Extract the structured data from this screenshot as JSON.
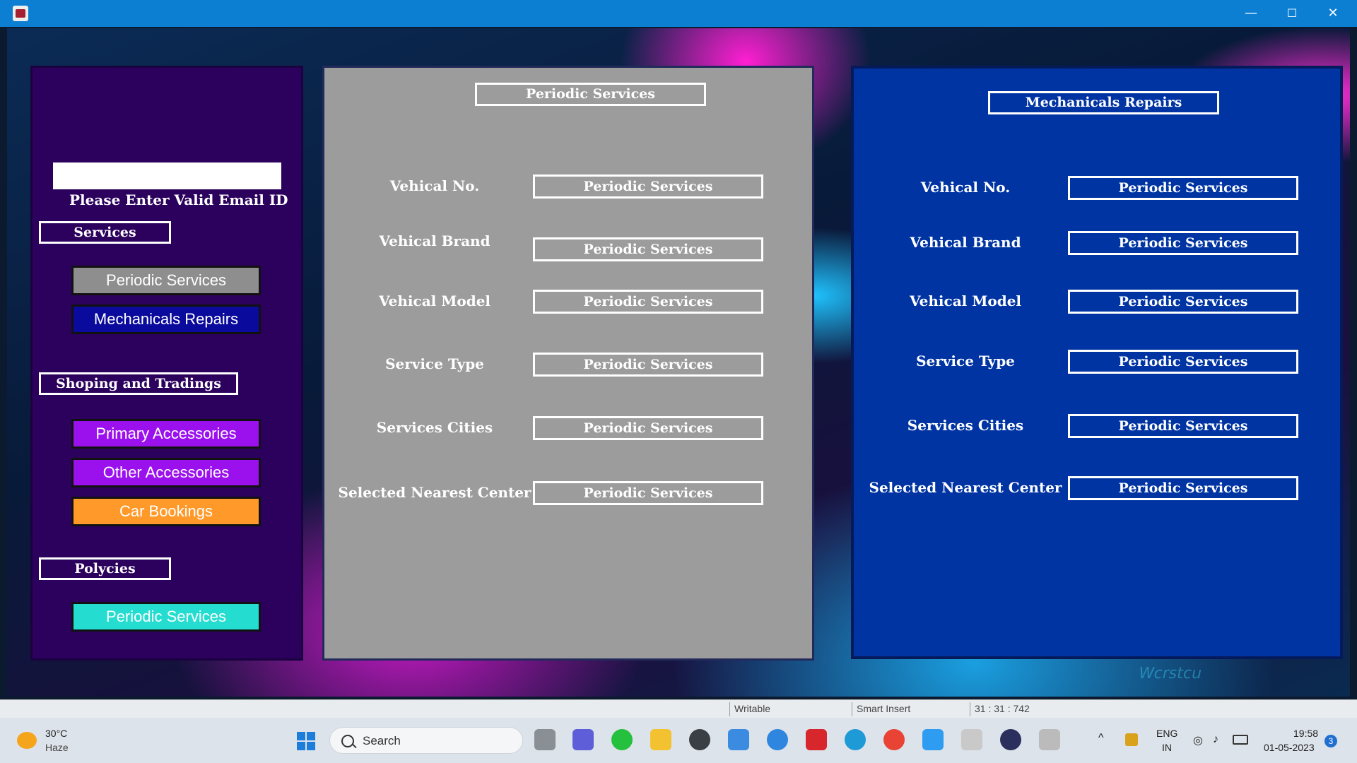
{
  "window": {
    "minimize": "—",
    "maximize": "☐",
    "close": "✕"
  },
  "background": {
    "watermark": "Wcrstcu"
  },
  "left": {
    "email_placeholder": "",
    "email_hint": "Please Enter Valid Email ID",
    "services_header": "Services",
    "periodic_btn": "Periodic Services",
    "mechanical_btn": "Mechanicals Repairs",
    "shopping_header": "Shoping and Tradings",
    "primary_btn": "Primary Accessories",
    "other_btn": "Other Accessories",
    "car_btn": "Car Bookings",
    "policies_header": "Polycies",
    "policies_btn": "Periodic Services"
  },
  "middle": {
    "title": "Periodic Services",
    "rows": [
      {
        "label": "Vehical No.",
        "value": "Periodic Services"
      },
      {
        "label": "Vehical Brand",
        "value": "Periodic Services"
      },
      {
        "label": "Vehical Model",
        "value": "Periodic Services"
      },
      {
        "label": "Service Type",
        "value": "Periodic Services"
      },
      {
        "label": "Services Cities",
        "value": "Periodic Services"
      },
      {
        "label": "Selected Nearest Center",
        "value": "Periodic Services"
      }
    ]
  },
  "right": {
    "title": "Mechanicals Repairs",
    "rows": [
      {
        "label": "Vehical No.",
        "value": "Periodic Services"
      },
      {
        "label": "Vehical Brand",
        "value": "Periodic Services"
      },
      {
        "label": "Vehical Model",
        "value": "Periodic Services"
      },
      {
        "label": "Service Type",
        "value": "Periodic Services"
      },
      {
        "label": "Services Cities",
        "value": "Periodic Services"
      },
      {
        "label": "Selected Nearest Center",
        "value": "Periodic Services"
      }
    ]
  },
  "statusbar": {
    "mode": "Writable",
    "insert": "Smart Insert",
    "position": "31 : 31 : 742"
  },
  "taskbar": {
    "weather_temp": "30°C",
    "weather_desc": "Haze",
    "search": "Search",
    "lang1": "ENG",
    "lang2": "IN",
    "time": "19:58",
    "date": "01-05-2023",
    "notif": "3"
  },
  "colors": {
    "left_panel": "#2c015d",
    "mid_panel": "#9c9c9c",
    "right_panel": "#0034a3",
    "btn_periodic": "#8e8e8e",
    "btn_mechanical": "#0a0a9c",
    "btn_primary": "#9b11ee",
    "btn_other": "#9b11ee",
    "btn_car": "#ff9a2a",
    "btn_policies": "#24ddd0"
  }
}
